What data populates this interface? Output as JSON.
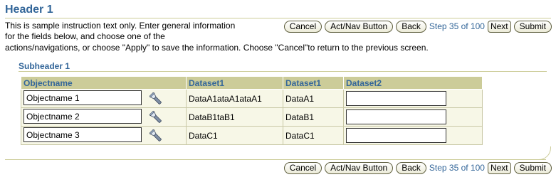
{
  "header": {
    "title": "Header 1"
  },
  "instructions": {
    "part1": "This is sample instruction text only.  Enter general information for the fields below, and choose one of the",
    "part2": "actions/navigations, or choose \"Apply\" to save the information. Choose \"Cancel\"to return to the previous screen."
  },
  "train": {
    "cancel_label": "Cancel",
    "actnav_label": "Act/Nav Button",
    "back_label": "Back",
    "step_text": "Step 35 of 100",
    "next_label": "Next",
    "submit_label": "Submit"
  },
  "subheader": {
    "title": "Subheader 1"
  },
  "table": {
    "columns": [
      "Objectname",
      "Dataset1",
      "Dataset1",
      "Dataset2"
    ],
    "rows": [
      {
        "name": "Objectname 1",
        "ds1a": "DataA1ataA1ataA1",
        "ds1b": "DataA1",
        "ds2": ""
      },
      {
        "name": "Objectname 2",
        "ds1a": "DataB1taB1",
        "ds1b": "DataB1",
        "ds2": ""
      },
      {
        "name": "Objectname 3",
        "ds1a": "DataC1",
        "ds1b": "DataC1",
        "ds2": ""
      }
    ]
  },
  "icons": {
    "lov": "flashlight-icon"
  },
  "colors": {
    "accent": "#336699",
    "header_bg": "#cccc99",
    "row_bg": "#f7f7e7"
  }
}
